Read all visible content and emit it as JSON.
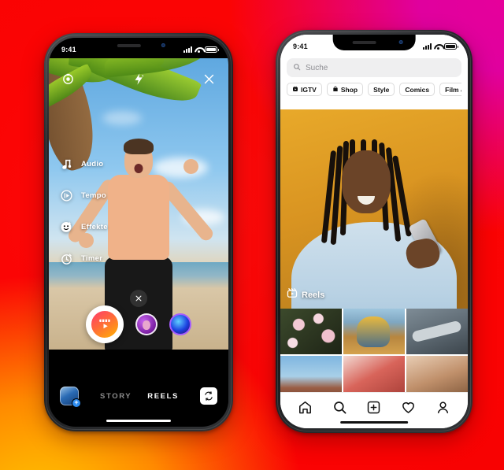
{
  "scene": {
    "background_colors": {
      "top_left": "#fb0b0b",
      "top_right": "#e0009e",
      "bottom_left": "#ffb400",
      "bottom_right": "#f50000"
    }
  },
  "left_phone": {
    "status_bar": {
      "time": "9:41",
      "signal_icon": "cellular-bars-icon",
      "wifi_icon": "wifi-icon",
      "battery_icon": "battery-icon"
    },
    "camera": {
      "top_controls": [
        {
          "name": "settings-icon",
          "glyph": "settings"
        },
        {
          "name": "flash-off-icon",
          "glyph": "flash-off"
        },
        {
          "name": "close-icon",
          "glyph": "close"
        }
      ],
      "side_menu": [
        {
          "label": "Audio",
          "icon": "music-note-icon"
        },
        {
          "label": "Tempo",
          "icon": "speed-play-icon"
        },
        {
          "label": "Effekte",
          "icon": "smiley-face-icon"
        },
        {
          "label": "Timer",
          "icon": "timer-icon"
        }
      ],
      "dismiss_label": "✕",
      "shutter_icon": "reels-clapper-icon",
      "effects": [
        {
          "name": "effect-bubble-purple"
        },
        {
          "name": "effect-bubble-blue"
        }
      ]
    },
    "bottom": {
      "gallery_icon": "gallery-thumbnail-icon",
      "gallery_badge": "+",
      "modes": [
        {
          "label": "STORY",
          "active": false
        },
        {
          "label": "REELS",
          "active": true
        }
      ],
      "flip_camera_icon": "flip-camera-icon"
    }
  },
  "right_phone": {
    "status_bar": {
      "time": "9:41",
      "signal_icon": "cellular-bars-icon",
      "wifi_icon": "wifi-icon",
      "battery_icon": "battery-icon"
    },
    "search": {
      "placeholder": "Suche",
      "icon": "search-icon"
    },
    "chips": [
      {
        "label": "IGTV",
        "icon": "igtv-icon"
      },
      {
        "label": "Shop",
        "icon": "shop-bag-icon"
      },
      {
        "label": "Style",
        "icon": ""
      },
      {
        "label": "Comics",
        "icon": ""
      },
      {
        "label": "Film & Fern",
        "icon": ""
      }
    ],
    "hero": {
      "badge_label": "Reels",
      "badge_icon": "reels-clapper-icon"
    },
    "grid": [
      {
        "name": "grid-cell-blossoms"
      },
      {
        "name": "grid-cell-kids-tree"
      },
      {
        "name": "grid-cell-skateboard"
      },
      {
        "name": "grid-cell-monument"
      },
      {
        "name": "grid-cell-red-hoodie"
      },
      {
        "name": "grid-cell-portrait"
      }
    ],
    "tabbar": [
      {
        "name": "tab-home",
        "icon": "home-icon"
      },
      {
        "name": "tab-search",
        "icon": "search-icon"
      },
      {
        "name": "tab-create",
        "icon": "plus-square-icon"
      },
      {
        "name": "tab-activity",
        "icon": "heart-icon"
      },
      {
        "name": "tab-profile",
        "icon": "person-icon"
      }
    ]
  }
}
